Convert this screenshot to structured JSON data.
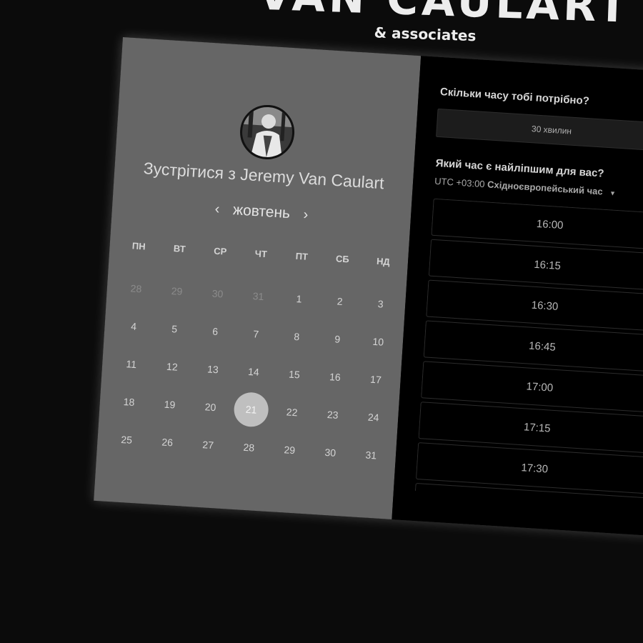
{
  "brand": {
    "title": "VAN CAULART",
    "subtitle": "& associates"
  },
  "scheduler": {
    "title": "Зустрітися з Jeremy Van Caulart",
    "month": "жовтень",
    "prev_icon": "‹",
    "next_icon": "›",
    "weekdays": [
      "ПН",
      "ВТ",
      "СР",
      "ЧТ",
      "ПТ",
      "СБ",
      "НД"
    ],
    "days": [
      {
        "label": "28",
        "muted": true
      },
      {
        "label": "29",
        "muted": true
      },
      {
        "label": "30",
        "muted": true
      },
      {
        "label": "31",
        "muted": true
      },
      {
        "label": "1"
      },
      {
        "label": "2"
      },
      {
        "label": "3"
      },
      {
        "label": "4"
      },
      {
        "label": "5"
      },
      {
        "label": "6"
      },
      {
        "label": "7"
      },
      {
        "label": "8"
      },
      {
        "label": "9"
      },
      {
        "label": "10"
      },
      {
        "label": "11"
      },
      {
        "label": "12"
      },
      {
        "label": "13"
      },
      {
        "label": "14"
      },
      {
        "label": "15"
      },
      {
        "label": "16"
      },
      {
        "label": "17"
      },
      {
        "label": "18"
      },
      {
        "label": "19"
      },
      {
        "label": "20"
      },
      {
        "label": "21",
        "selected": true
      },
      {
        "label": "22"
      },
      {
        "label": "23"
      },
      {
        "label": "24"
      },
      {
        "label": "25"
      },
      {
        "label": "26"
      },
      {
        "label": "27"
      },
      {
        "label": "28"
      },
      {
        "label": "29"
      },
      {
        "label": "30"
      },
      {
        "label": "31"
      }
    ]
  },
  "booking": {
    "duration_question": "Скільки часу тобі потрібно?",
    "duration_value": "30 хвилин",
    "time_question": "Який час є найліпшим для вас?",
    "tz_offset": "UTC +03:00",
    "tz_name": "Східноєвропейський час",
    "tz_caret": "▼",
    "slots": [
      "16:00",
      "16:15",
      "16:30",
      "16:45",
      "17:00",
      "17:15",
      "17:30",
      ""
    ]
  },
  "colors": {
    "background": "#0b0b0b",
    "calendar_panel": "#666666",
    "time_panel": "#000000",
    "selected_day": "#bfbfbf"
  }
}
